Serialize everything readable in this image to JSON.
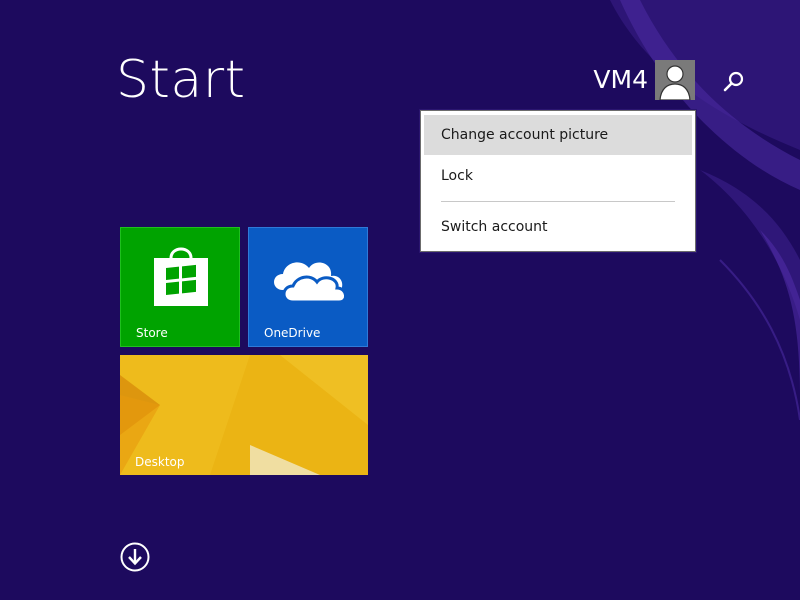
{
  "screen": {
    "title": "Start",
    "background_color": "#1d0a5e"
  },
  "user": {
    "name": "VM4",
    "avatar_icon": "user-silhouette-icon"
  },
  "search": {
    "icon": "search-icon"
  },
  "account_menu": {
    "items": [
      {
        "label": "Change account picture",
        "highlighted": true
      },
      {
        "label": "Lock",
        "highlighted": false
      },
      {
        "label": "Switch account",
        "highlighted": false
      }
    ]
  },
  "tiles": [
    {
      "label": "Store",
      "color": "#00a300",
      "icon": "store-bag-icon"
    },
    {
      "label": "OneDrive",
      "color": "#0a5bc4",
      "icon": "cloud-icon"
    },
    {
      "label": "Desktop",
      "color": "#e9b012",
      "icon": "desktop-wallpaper"
    }
  ],
  "all_apps": {
    "icon": "down-arrow-circle-icon"
  }
}
